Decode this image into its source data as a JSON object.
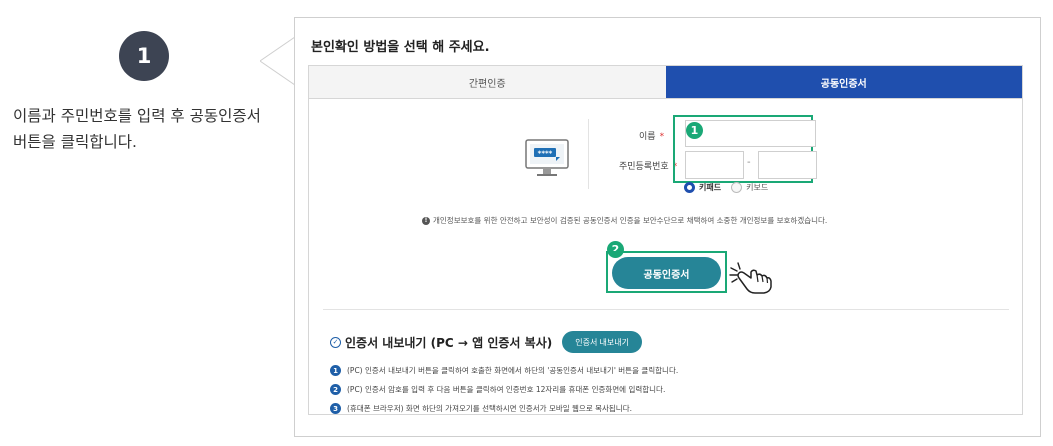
{
  "step": {
    "number": "1",
    "description": "이름과 주민번호를 입력 후 공동인증서 버튼을 클릭합니다."
  },
  "panel": {
    "title": "본인확인 방법을 선택 해 주세요.",
    "tabs": [
      {
        "label": "간편인증",
        "active": false
      },
      {
        "label": "공동인증서",
        "active": true
      }
    ],
    "form": {
      "name_label": "이름",
      "rrn_label": "주민등록번호",
      "required_mark": "*",
      "name_value": "",
      "rrn_front_value": "",
      "rrn_back_value": "",
      "dash": "-",
      "keypad_options": [
        {
          "label": "키패드",
          "selected": true
        },
        {
          "label": "키보드",
          "selected": false
        }
      ]
    },
    "monitor_icon_text": "****",
    "notice": "개인정보보호를 위한 안전하고 보안성이 검증된 공동인증서 인증을 보안수단으로 채택하여 소중한 개인정보를 보호하겠습니다.",
    "annotations": {
      "first": "1",
      "second": "2"
    },
    "cert_button_label": "공동인증서",
    "export": {
      "title": "인증서 내보내기 (PC → 앱 인증서 복사)",
      "button_label": "인증서 내보내기",
      "steps": [
        {
          "num": "1",
          "text": "(PC) 인증서 내보내기 버튼을 클릭하여 호출한 화면에서 하단의 '공동인증서 내보내기' 버튼을 클릭합니다."
        },
        {
          "num": "2",
          "text": "(PC) 인증서 암호를 입력 후 다음 버튼을 클릭하여 인증번호 12자리를 휴대폰 인증화면에 입력합니다."
        },
        {
          "num": "3",
          "text": "(휴대폰 브라우저) 화면 하단의 가져오기를 선택하시면 인증서가 모바일 웹으로 복사됩니다."
        }
      ]
    }
  },
  "colors": {
    "active_tab": "#1f4fae",
    "highlight_green": "#1aa876",
    "button_teal": "#268597",
    "step_badge": "#3d4453"
  }
}
